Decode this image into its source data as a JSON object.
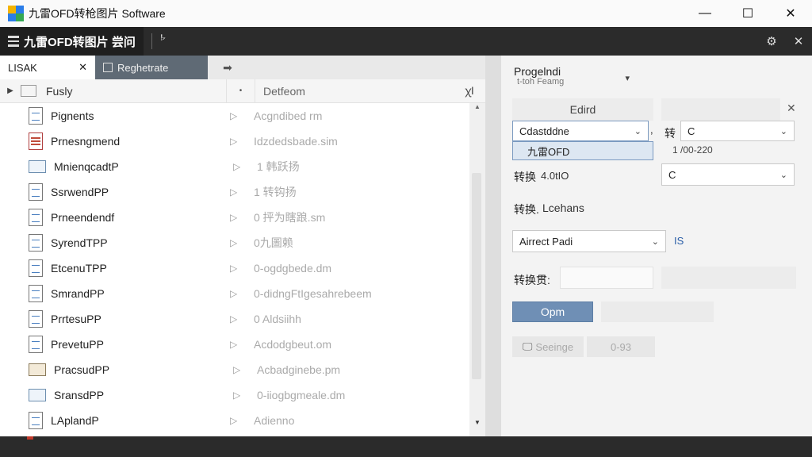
{
  "window": {
    "title": "九雷OFD转枪图片 Software",
    "controls": {
      "minimize": "—",
      "maximize": "☐",
      "close": "✕"
    }
  },
  "toolbar": {
    "app_title": "九雷OFD转图片 尝问",
    "sort_glyph": "ꜝꜘ",
    "help_glyph": "⚙",
    "close_glyph": "✕"
  },
  "tabs": [
    {
      "label": "LISAK",
      "close": "✕"
    },
    {
      "label": "Reghetrate"
    }
  ],
  "tab_arrow": "➡",
  "list_header": {
    "expander": "▶",
    "name": "Fusly",
    "sort": "•",
    "detail": "Detfeom",
    "end": "ꭓI"
  },
  "files": [
    {
      "name": "Pignents",
      "detail": "Acgndibed rm",
      "icon": "doc-icon"
    },
    {
      "name": "Prnesngmend",
      "detail": "Idzdedsbade.sim",
      "icon": "sheet-icon"
    },
    {
      "name": "MnienqcadtP",
      "detail": "1 韩跃扬",
      "icon": "folder-icon"
    },
    {
      "name": "SsrwendPP",
      "detail": "1 转钩扬",
      "icon": "doc-icon"
    },
    {
      "name": "Prneendendf",
      "detail": "0 抨为瞎踉.sm",
      "icon": "doc-icon"
    },
    {
      "name": "SyrendTPP",
      "detail": "0九圖赖",
      "icon": "doc-icon"
    },
    {
      "name": "EtcenuTPP",
      "detail": "0-ogdgbede.dm",
      "icon": "doc-icon"
    },
    {
      "name": "SmrandPP",
      "detail": "0-didngFtIgesahrebeem",
      "icon": "doc-icon"
    },
    {
      "name": "PrrtesuPP",
      "detail": "0 Aldsiihh",
      "icon": "doc-icon"
    },
    {
      "name": "PrevetuPP",
      "detail": "Acdodgbeut.om",
      "icon": "doc-icon"
    },
    {
      "name": "PracsudPP",
      "detail": "Acbadginebe.pm",
      "icon": "folder-beige-icon"
    },
    {
      "name": "SransdPP",
      "detail": "0-iiogbgmeale.dm",
      "icon": "folder-icon"
    },
    {
      "name": "LAplandP",
      "detail": "Adienno",
      "icon": "doc-icon"
    }
  ],
  "scroll": {
    "up": "▲",
    "down": "▼"
  },
  "right": {
    "profile_label": "Progelndi",
    "profile_value": "t-toh Feamg",
    "profile_chev": "▾",
    "field_label": "Edird",
    "field_close": "✕",
    "combo1": {
      "value": "Cdastddne",
      "chev": "⌄"
    },
    "combo1_suffix": ",",
    "combo1_option": "九雷OFD",
    "convert_short": "转",
    "combo2": {
      "value": "C",
      "chev": "⌄"
    },
    "ratio_text": "1 /00-220",
    "convert_label": "转换",
    "convert_value": "4.0tIO",
    "combo3": {
      "value": "C",
      "chev": "⌄"
    },
    "convert_mode_label": "转换.",
    "convert_mode_value": "Lcehans",
    "combo4": {
      "value": "Airrect Padi",
      "chev": "⌄"
    },
    "combo4_side": "IS",
    "page_label": "转换贯:",
    "open_button": "Opm",
    "settings_icon": "🖵",
    "settings_button": "Seeinge",
    "settings_value": "0-93"
  }
}
